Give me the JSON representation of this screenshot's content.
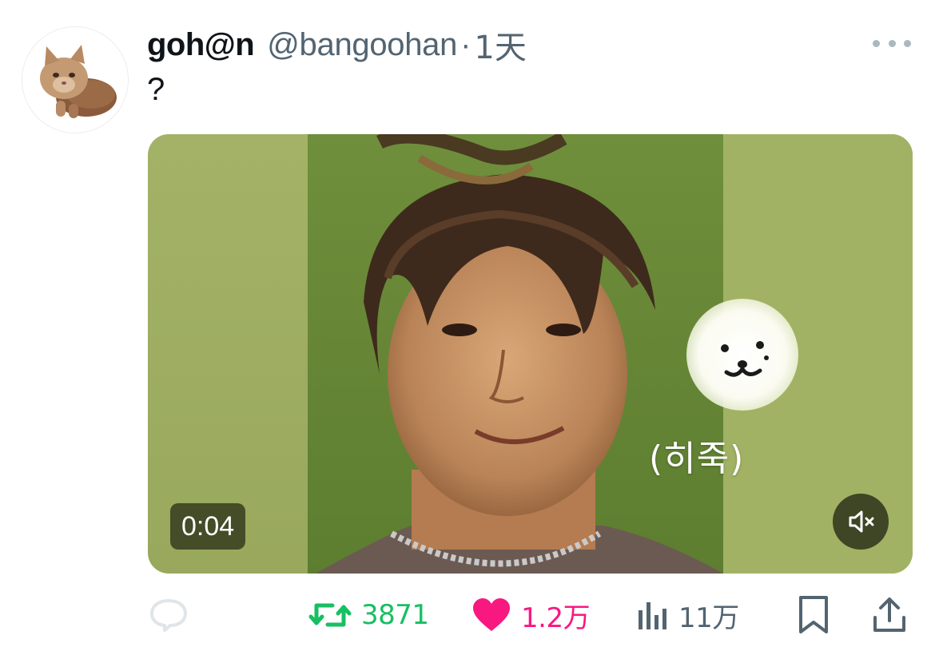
{
  "tweet": {
    "author": {
      "display_name": "goh@n",
      "handle": "@bangoohan",
      "avatar": "kitten-avatar"
    },
    "separator": "·",
    "time": "1天",
    "more_icon": "more-horizontal-icon",
    "text": "?"
  },
  "media": {
    "type": "video",
    "duration": "0:04",
    "caption": "(히죽)",
    "sticker": "dog-face-sticker",
    "mute_icon": "volume-muted-icon"
  },
  "actions": {
    "reply": {
      "icon": "reply-icon",
      "count": ""
    },
    "retweet": {
      "icon": "retweet-icon",
      "count": "3871",
      "color": "#17bf63"
    },
    "like": {
      "icon": "heart-icon",
      "count": "1.2万",
      "color": "#f91880",
      "liked": true
    },
    "views": {
      "icon": "views-icon",
      "count": "11万"
    },
    "bookmark": {
      "icon": "bookmark-icon"
    },
    "share": {
      "icon": "share-icon"
    }
  }
}
